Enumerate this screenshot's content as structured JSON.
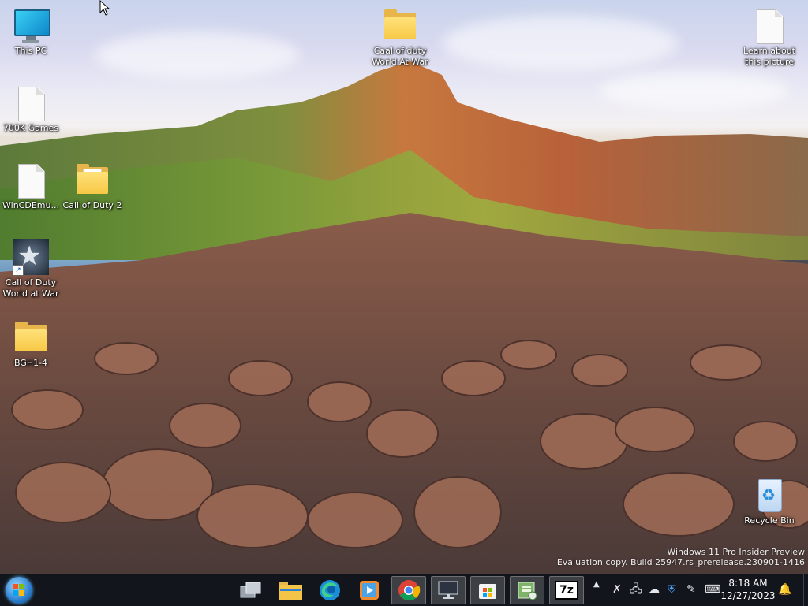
{
  "desktop": {
    "icons": [
      {
        "name": "This PC",
        "kind": "this-pc"
      },
      {
        "name": "700K Games",
        "kind": "document"
      },
      {
        "name": "WinCDEmu...",
        "kind": "document"
      },
      {
        "name": "Call of Duty 2",
        "kind": "folder-open"
      },
      {
        "name": "Call of Duty World at War",
        "kind": "game-shortcut"
      },
      {
        "name": "BGH1-4",
        "kind": "folder"
      },
      {
        "name": "Caal of duty World At War",
        "kind": "folder"
      },
      {
        "name": "Learn about this picture",
        "kind": "document"
      },
      {
        "name": "Recycle Bin",
        "kind": "recycle-bin"
      }
    ]
  },
  "watermark": {
    "line1": "Windows 11 Pro Insider Preview",
    "line2": "Evaluation copy. Build 25947.rs_prerelease.230901-1416"
  },
  "taskbar": {
    "pinned": [
      {
        "app": "Task View",
        "icon": "task-view-icon"
      },
      {
        "app": "File Explorer",
        "icon": "file-explorer-icon"
      },
      {
        "app": "Microsoft Edge",
        "icon": "edge-icon"
      },
      {
        "app": "Media Player",
        "icon": "media-player-icon"
      },
      {
        "app": "Google Chrome",
        "icon": "chrome-icon"
      },
      {
        "app": "Remote Desktop",
        "icon": "remote-desktop-icon"
      },
      {
        "app": "Microsoft Store",
        "icon": "store-icon"
      },
      {
        "app": "Archive Tool",
        "icon": "archive-icon"
      },
      {
        "app": "7-Zip",
        "icon": "7zip-icon",
        "label": "7z"
      }
    ],
    "clock": {
      "time": "8:18 AM",
      "date": "12/27/2023"
    },
    "colors": {
      "taskbar": "#12161c",
      "active": "#ffffff2e"
    }
  }
}
